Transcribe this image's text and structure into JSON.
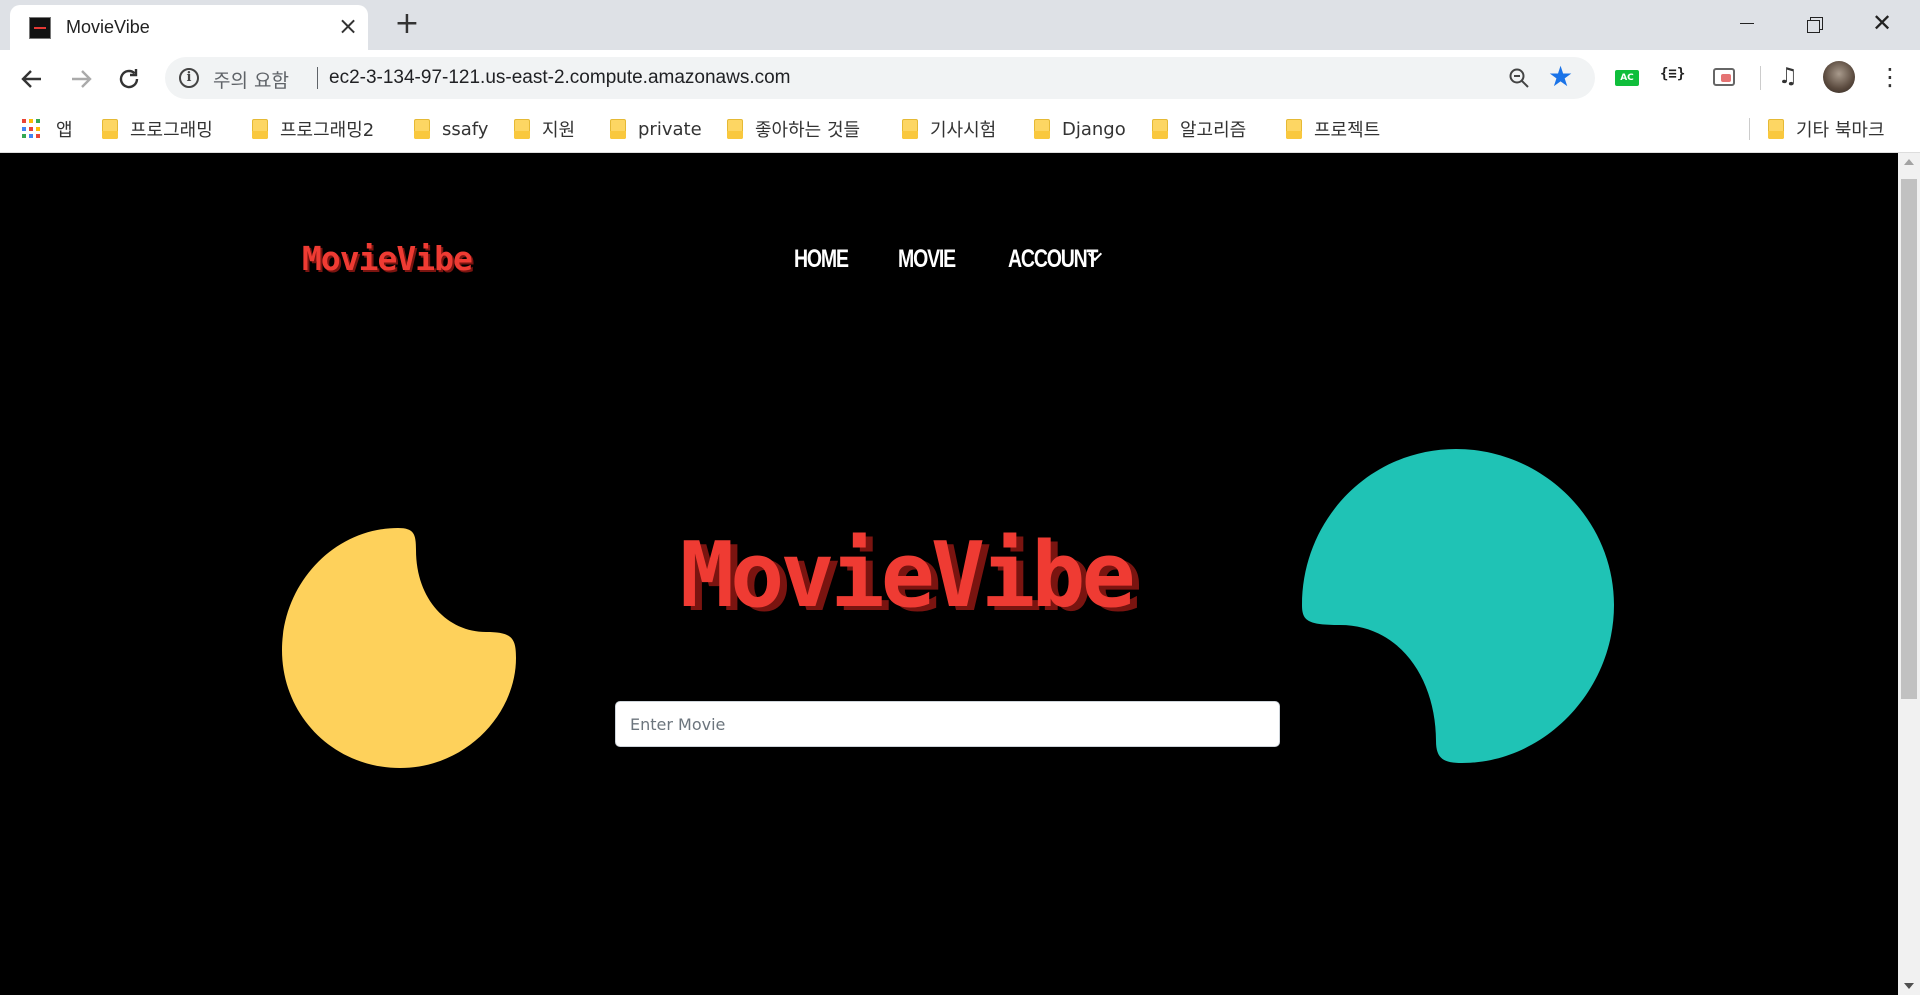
{
  "browser": {
    "tab_title": "MovieVibe",
    "security_label": "주의 요함",
    "url": "ec2-3-134-97-121.us-east-2.compute.amazonaws.com",
    "ext_ac_label": "AC",
    "ext_json_label": "{≡}"
  },
  "bookmarks": {
    "apps_label": "앱",
    "items": [
      "프로그래밍",
      "프로그래밍2",
      "ssafy",
      "지원",
      "private",
      "좋아하는 것들",
      "기사시험",
      "Django",
      "알고리즘",
      "프로젝트"
    ],
    "other_label": "기타 북마크"
  },
  "site": {
    "logo": "MovieVibe",
    "nav": {
      "home": "HOME",
      "movie": "MOVIE",
      "account": "ACCOUNT"
    },
    "hero_title": "MovieVibe",
    "search": {
      "placeholder": "Enter Movie",
      "value": ""
    }
  },
  "colors": {
    "brand_red": "#ef3b33",
    "brand_red_shadow": "#7a1410",
    "yellow_blob": "#fed15b",
    "teal_blob": "#1fc3b5",
    "background": "#000000"
  },
  "icons": {
    "back": "arrow-left-icon",
    "forward": "arrow-right-icon",
    "reload": "reload-icon",
    "info": "info-icon",
    "zoom": "zoom-out-icon",
    "star": "star-icon",
    "folder": "folder-icon",
    "apps": "apps-grid-icon",
    "menu": "kebab-menu-icon",
    "chevron": "chevron-down-icon"
  }
}
